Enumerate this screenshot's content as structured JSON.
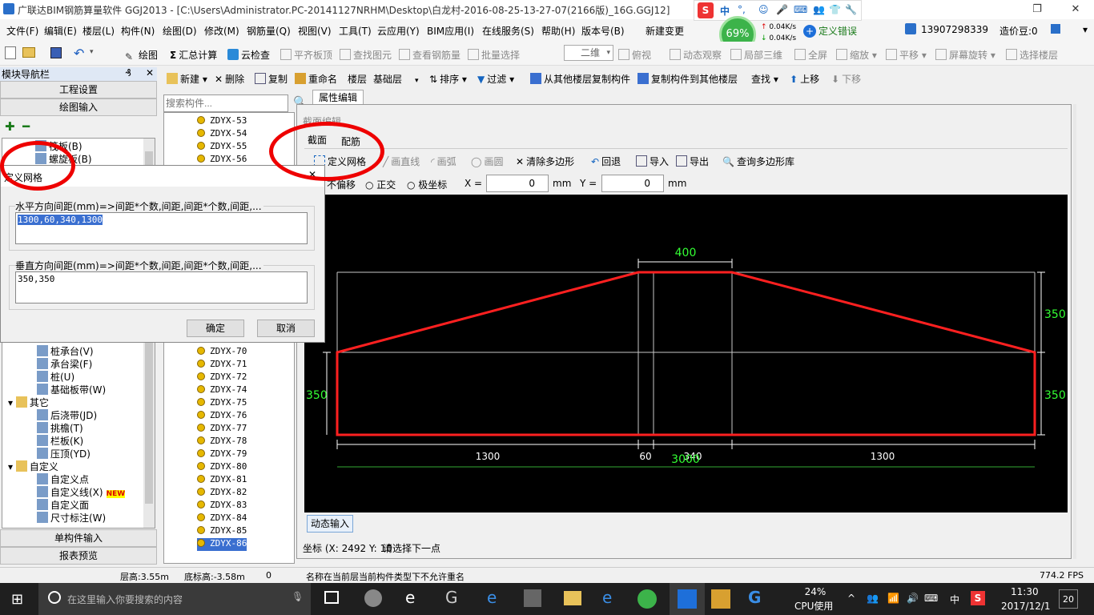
{
  "window": {
    "title": "广联达BIM钢筋算量软件 GGJ2013 - [C:\\Users\\Administrator.PC-20141127NRHM\\Desktop\\白龙村-2016-08-25-13-27-07(2166版)_16G.GGJ12]"
  },
  "menu": [
    "文件(F)",
    "编辑(E)",
    "楼层(L)",
    "构件(N)",
    "绘图(D)",
    "修改(M)",
    "钢筋量(Q)",
    "视图(V)",
    "工具(T)",
    "云应用(Y)",
    "BIM应用(I)",
    "在线服务(S)",
    "帮助(H)",
    "版本号(B)",
    "新建变更"
  ],
  "overlay": {
    "progress_pct": "69%",
    "net_up": "0.04K/s",
    "net_down": "0.04K/s",
    "ime_badge": "中",
    "error_label": "定义错误",
    "phone": "13907298339",
    "points": "造价豆:0"
  },
  "toolbar1": {
    "draw": "绘图",
    "summary": "汇总计算",
    "cloud_check": "云检查",
    "flat_slab": "平齐板顶",
    "find_elem": "查找图元",
    "view_rebar": "查看钢筋量",
    "batch_select": "批量选择",
    "view_mode": "二维",
    "top_view": "俯视",
    "dynamic_view": "动态观察",
    "local_3d": "局部三维",
    "fullscreen": "全屏",
    "zoom": "缩放",
    "pan": "平移",
    "rotate": "屏幕旋转",
    "select_floor": "选择楼层"
  },
  "toolbar2": {
    "new": "新建",
    "delete": "删除",
    "copy": "复制",
    "rename": "重命名",
    "floor_label": "楼层",
    "floor_value": "基础层",
    "sort": "排序",
    "filter": "过滤",
    "copy_from": "从其他楼层复制构件",
    "copy_to": "复制构件到其他楼层",
    "find": "查找",
    "move_up": "上移",
    "move_down": "下移"
  },
  "nav": {
    "title": "模块导航栏",
    "project_settings": "工程设置",
    "draw_input": "绘图输入",
    "single_input": "单构件输入",
    "report_preview": "报表预览",
    "tree_top": [
      "筏板(B)",
      "螺旋板(B)"
    ],
    "tree_bottom": [
      {
        "label": "桩承台(V)",
        "level": 2
      },
      {
        "label": "承台梁(F)",
        "level": 2
      },
      {
        "label": "桩(U)",
        "level": 2
      },
      {
        "label": "基础板带(W)",
        "level": 2
      },
      {
        "label": "其它",
        "level": 1
      },
      {
        "label": "后浇带(JD)",
        "level": 2
      },
      {
        "label": "挑檐(T)",
        "level": 2
      },
      {
        "label": "栏板(K)",
        "level": 2
      },
      {
        "label": "压顶(YD)",
        "level": 2
      },
      {
        "label": "自定义",
        "level": 1
      },
      {
        "label": "自定义点",
        "level": 2
      },
      {
        "label": "自定义线(X)",
        "level": 2
      },
      {
        "label": "自定义面",
        "level": 2
      },
      {
        "label": "尺寸标注(W)",
        "level": 2
      }
    ],
    "new_badge": "NEW"
  },
  "search": {
    "placeholder": "搜索构件..."
  },
  "components_top": [
    "ZDYX-53",
    "ZDYX-54",
    "ZDYX-55",
    "ZDYX-56"
  ],
  "components_bottom": [
    "ZDYX-70",
    "ZDYX-71",
    "ZDYX-72",
    "ZDYX-74",
    "ZDYX-75",
    "ZDYX-76",
    "ZDYX-77",
    "ZDYX-78",
    "ZDYX-79",
    "ZDYX-80",
    "ZDYX-81",
    "ZDYX-82",
    "ZDYX-83",
    "ZDYX-84",
    "ZDYX-85",
    "ZDYX-86"
  ],
  "props_tab": "属性编辑",
  "section_dialog": {
    "title": "截面编辑",
    "tab_section": "截面",
    "tab_rebar": "配筋",
    "define_grid": "定义网格",
    "draw_line": "画直线",
    "draw_arc": "画弧",
    "draw_circle": "画圆",
    "clear_polygon": "清除多边形",
    "undo": "回退",
    "import": "导入",
    "export": "导出",
    "query_lib": "查询多边形库",
    "no_offset": "不偏移",
    "orthogonal": "正交",
    "polar": "极坐标",
    "x_label": "X =",
    "x_value": "0",
    "y_label": "Y =",
    "y_value": "0",
    "unit": "mm",
    "dynamic_input": "动态输入",
    "coord_label": "坐标 (X: 2492 Y: 10",
    "prompt": "请选择下一点"
  },
  "drawing": {
    "dim_top": "400",
    "dim_right_top": "350",
    "dim_right_bottom": "350",
    "dim_left": "350",
    "dim_b1": "1300",
    "dim_b2": "60",
    "dim_b3": "340",
    "dim_b4": "1300",
    "dim_total": "3000"
  },
  "grid_dialog": {
    "title": "定义网格",
    "h_label": "水平方向间距(mm)=>间距*个数,间距,间距*个数,间距,...",
    "h_value": "1300,60,340,1300",
    "v_label": "垂直方向间距(mm)=>间距*个数,间距,间距*个数,间距,...",
    "v_value": "350,350",
    "ok": "确定",
    "cancel": "取消"
  },
  "status": {
    "floor_height": "层高:3.55m",
    "base_height": "底标高:-3.58m",
    "num": "0",
    "message": "名称在当前层当前构件类型下不允许重名",
    "fps": "774.2 FPS"
  },
  "taskbar": {
    "search_placeholder": "在这里输入你要搜索的内容",
    "cpu_pct": "24%",
    "cpu_label": "CPU使用",
    "ime": "中",
    "time": "11:30",
    "date": "2017/12/1",
    "notif": "20"
  }
}
